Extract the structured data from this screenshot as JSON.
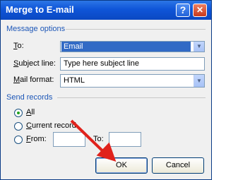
{
  "window": {
    "title": "Merge to E-mail",
    "help_glyph": "?",
    "close_glyph": "✕"
  },
  "message_options": {
    "group_label": "Message options",
    "to_label_u": "T",
    "to_label_rest": "o:",
    "to_value": "Email",
    "subject_label_u": "S",
    "subject_label_rest": "ubject line:",
    "subject_value": "Type here subject line",
    "format_label_u": "M",
    "format_label_rest": "ail format:",
    "format_value": "HTML"
  },
  "send_records": {
    "group_label": "Send records",
    "all_u": "A",
    "all_rest": "ll",
    "current_u": "C",
    "current_rest": "urrent record",
    "from_u": "F",
    "from_rest": "rom:",
    "to_label": "To:",
    "selected": "All"
  },
  "buttons": {
    "ok": "OK",
    "cancel": "Cancel"
  },
  "annotation_color": "#e0221c"
}
